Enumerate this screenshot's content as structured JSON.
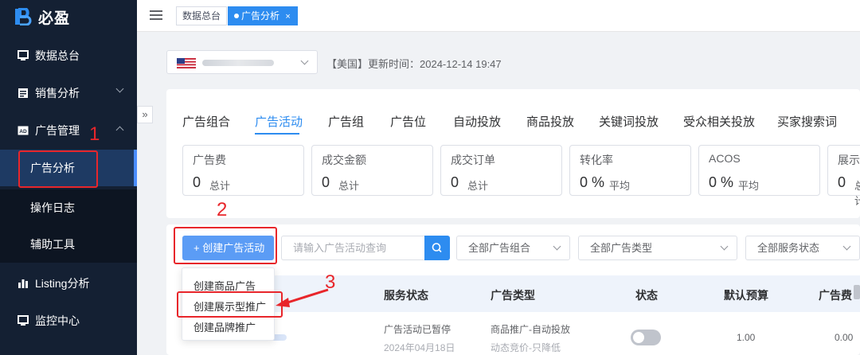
{
  "app": {
    "logo_text": "必盈"
  },
  "sidebar": {
    "items": [
      {
        "label": "数据总台",
        "icon": "monitor-icon"
      },
      {
        "label": "销售分析",
        "icon": "list-icon"
      },
      {
        "label": "广告管理",
        "icon": "ad-icon"
      },
      {
        "label": "Listing分析",
        "icon": "bar-chart-icon"
      },
      {
        "label": "监控中心",
        "icon": "monitor-icon"
      }
    ],
    "sub_items": [
      {
        "label": "广告分析"
      },
      {
        "label": "操作日志"
      },
      {
        "label": "辅助工具"
      }
    ]
  },
  "topbar": {
    "tabs": [
      {
        "label": "数据总台"
      },
      {
        "label": "广告分析"
      }
    ],
    "close_glyph": "×"
  },
  "header": {
    "update_text": "【美国】更新时间：2024-12-14 19:47"
  },
  "ad_tabs": [
    "广告组合",
    "广告活动",
    "广告组",
    "广告位",
    "自动投放",
    "商品投放",
    "关键词投放",
    "受众相关投放",
    "买家搜索词"
  ],
  "metrics": [
    {
      "title": "广告费",
      "value": "0",
      "unit": "总计"
    },
    {
      "title": "成交金额",
      "value": "0",
      "unit": "总计"
    },
    {
      "title": "成交订单",
      "value": "0",
      "unit": "总计"
    },
    {
      "title": "转化率",
      "value": "0 %",
      "unit": "平均"
    },
    {
      "title": "ACOS",
      "value": "0 %",
      "unit": "平均"
    },
    {
      "title": "展示",
      "value": "0",
      "unit": "总计"
    }
  ],
  "toolbar": {
    "create_label": "+ 创建广告活动",
    "search_placeholder": "请输入广告活动查询",
    "filter_portfolio": "全部广告组合",
    "filter_type": "全部广告类型",
    "filter_status": "全部服务状态"
  },
  "dropdown": [
    "创建商品广告",
    "创建展示型推广",
    "创建品牌推广"
  ],
  "table": {
    "headers": [
      "服务状态",
      "广告类型",
      "状态",
      "默认预算",
      "广告费"
    ],
    "row": {
      "service_status": "广告活动已暂停",
      "service_date": "2024年04月18日",
      "ad_type": "商品推广-自动投放",
      "bid_strategy": "动态竞价-只降低",
      "budget": "1.00",
      "spend": "0.00"
    }
  },
  "annotations": [
    "1",
    "2",
    "3"
  ],
  "colors": {
    "sidebar_bg": "#142033",
    "primary": "#2d8cf0",
    "highlight": "#e8262b"
  }
}
